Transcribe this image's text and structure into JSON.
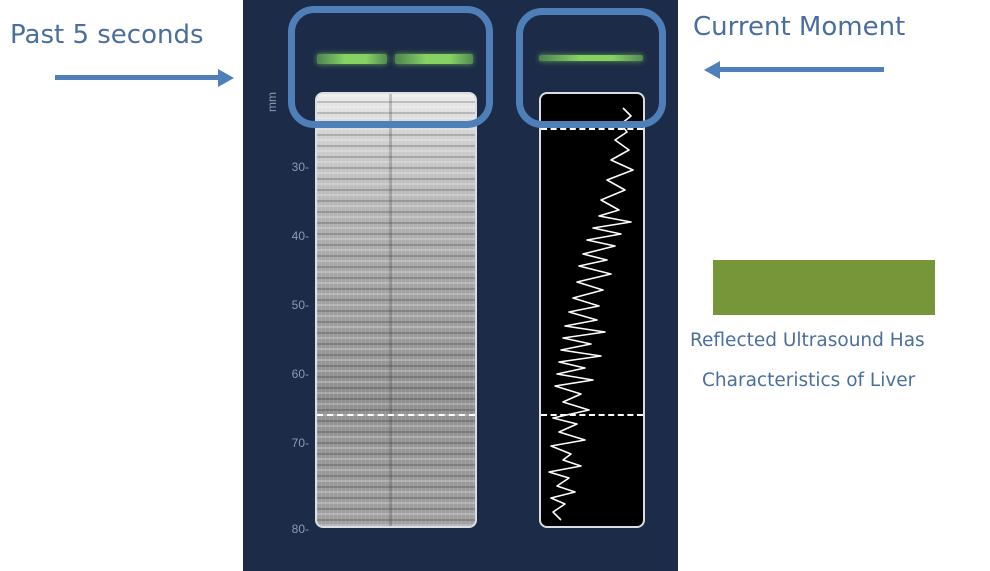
{
  "labels": {
    "past": "Past 5 seconds",
    "current": "Current Moment",
    "caption_line1": "Reflected Ultrasound Has",
    "caption_line2": "Characteristics of Liver"
  },
  "axis": {
    "unit": "mm",
    "ticks": [
      "30-",
      "40-",
      "50-",
      "60-",
      "70-",
      "80-"
    ]
  },
  "colors": {
    "annotation": "#4a6f9c",
    "arrow": "#4f7fb9",
    "liver_swatch": "#77963a",
    "panel": "#1c2b47",
    "indicator": "#8cdc64"
  },
  "icons": [
    "arrow-right-icon",
    "arrow-left-icon"
  ]
}
